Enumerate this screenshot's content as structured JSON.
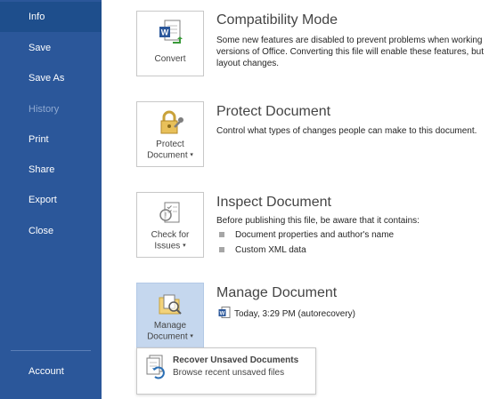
{
  "sidebar": {
    "items": [
      {
        "label": "Info"
      },
      {
        "label": "Save"
      },
      {
        "label": "Save As"
      },
      {
        "label": "History"
      },
      {
        "label": "Print"
      },
      {
        "label": "Share"
      },
      {
        "label": "Export"
      },
      {
        "label": "Close"
      },
      {
        "label": "Account"
      }
    ]
  },
  "sections": {
    "compatibility": {
      "button_label": "Convert",
      "title": "Compatibility Mode",
      "desc": [
        "Some new features are disabled to prevent problems when working",
        "versions of Office. Converting this file will enable these features, but",
        "layout changes."
      ],
      "icon": "word-doc-convert-icon"
    },
    "protect": {
      "button_line1": "Protect",
      "button_line2": "Document",
      "title": "Protect Document",
      "desc": "Control what types of changes people can make to this document.",
      "icon": "lock-key-icon"
    },
    "inspect": {
      "button_line1": "Check for",
      "button_line2": "Issues",
      "title": "Inspect Document",
      "desc": "Before publishing this file, be aware that it contains:",
      "bullets": [
        "Document properties and author's name",
        "Custom XML data"
      ],
      "icon": "checklist-magnifier-icon"
    },
    "manage": {
      "button_line1": "Manage",
      "button_line2": "Document",
      "title": "Manage Document",
      "version": "Today, 3:29 PM (autorecovery)",
      "icon": "folder-magnifier-icon"
    }
  },
  "dropdown": {
    "title": "Recover Unsaved Documents",
    "subtitle": "Browse recent unsaved files",
    "icon": "recover-documents-icon"
  },
  "colors": {
    "sidebar_bg": "#2b579a",
    "sidebar_active": "#1e4e8c",
    "selected_tile": "#c5d7ee"
  }
}
